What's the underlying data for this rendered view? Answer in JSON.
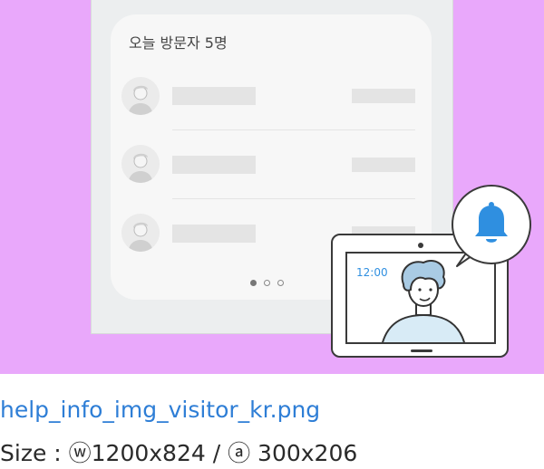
{
  "card": {
    "title": "오늘 방문자 5명"
  },
  "pagination": {
    "count": 3,
    "active": 0
  },
  "tablet": {
    "time": "12:00"
  },
  "colors": {
    "banner": "#e9a8fb",
    "accent": "#2f8fe0",
    "bell": "#2f8fe0"
  },
  "icons": {
    "notification": "bell-icon",
    "visitor": "avatar-icon"
  },
  "caption": {
    "filename": "help_info_img_visitor_kr.png",
    "size": "Size : ⓦ1200x824 / ⓐ 300x206"
  }
}
